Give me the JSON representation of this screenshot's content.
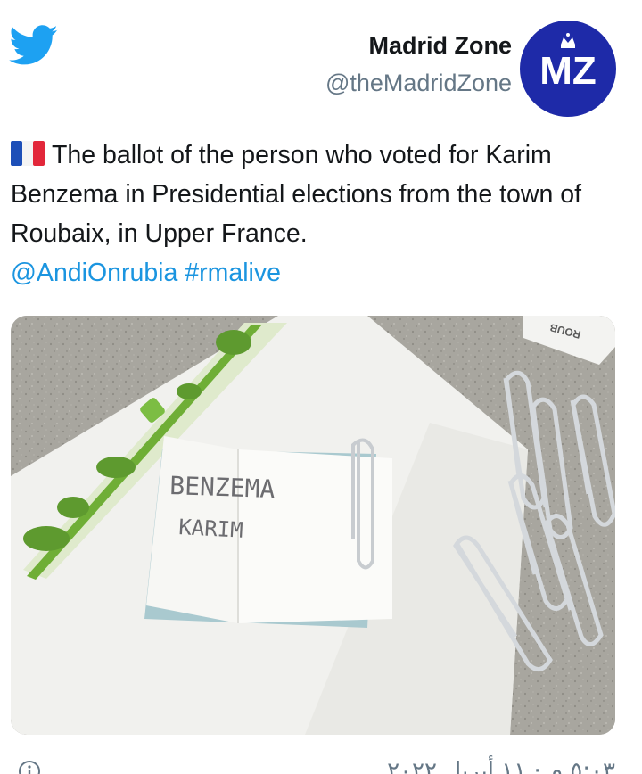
{
  "header": {
    "platform_icon": "twitter-bird-icon",
    "author_name": "Madrid Zone",
    "author_handle": "@theMadridZone",
    "avatar_text": "MZ",
    "avatar_icon": "crown-icon"
  },
  "tweet": {
    "flag_icon": "france-flag-icon",
    "text": "The ballot of the person who voted for Karim Benzema in Presidential elections from the town of Roubaix, in Upper France.",
    "mention": "@AndiOnrubia",
    "hashtag": "#rmalive"
  },
  "media": {
    "ballot_line1": "BENZEMA",
    "ballot_line2": "KARIM",
    "corner_card_text": "ROUB"
  },
  "footer": {
    "info_icon": "info-icon",
    "timestamp": "٥:٠٣ م · ١١ أبريل ٢٠٢٢"
  },
  "colors": {
    "link": "#1b95e0",
    "twitter_blue": "#1da1f2",
    "avatar_blue": "#1e2aa8"
  }
}
